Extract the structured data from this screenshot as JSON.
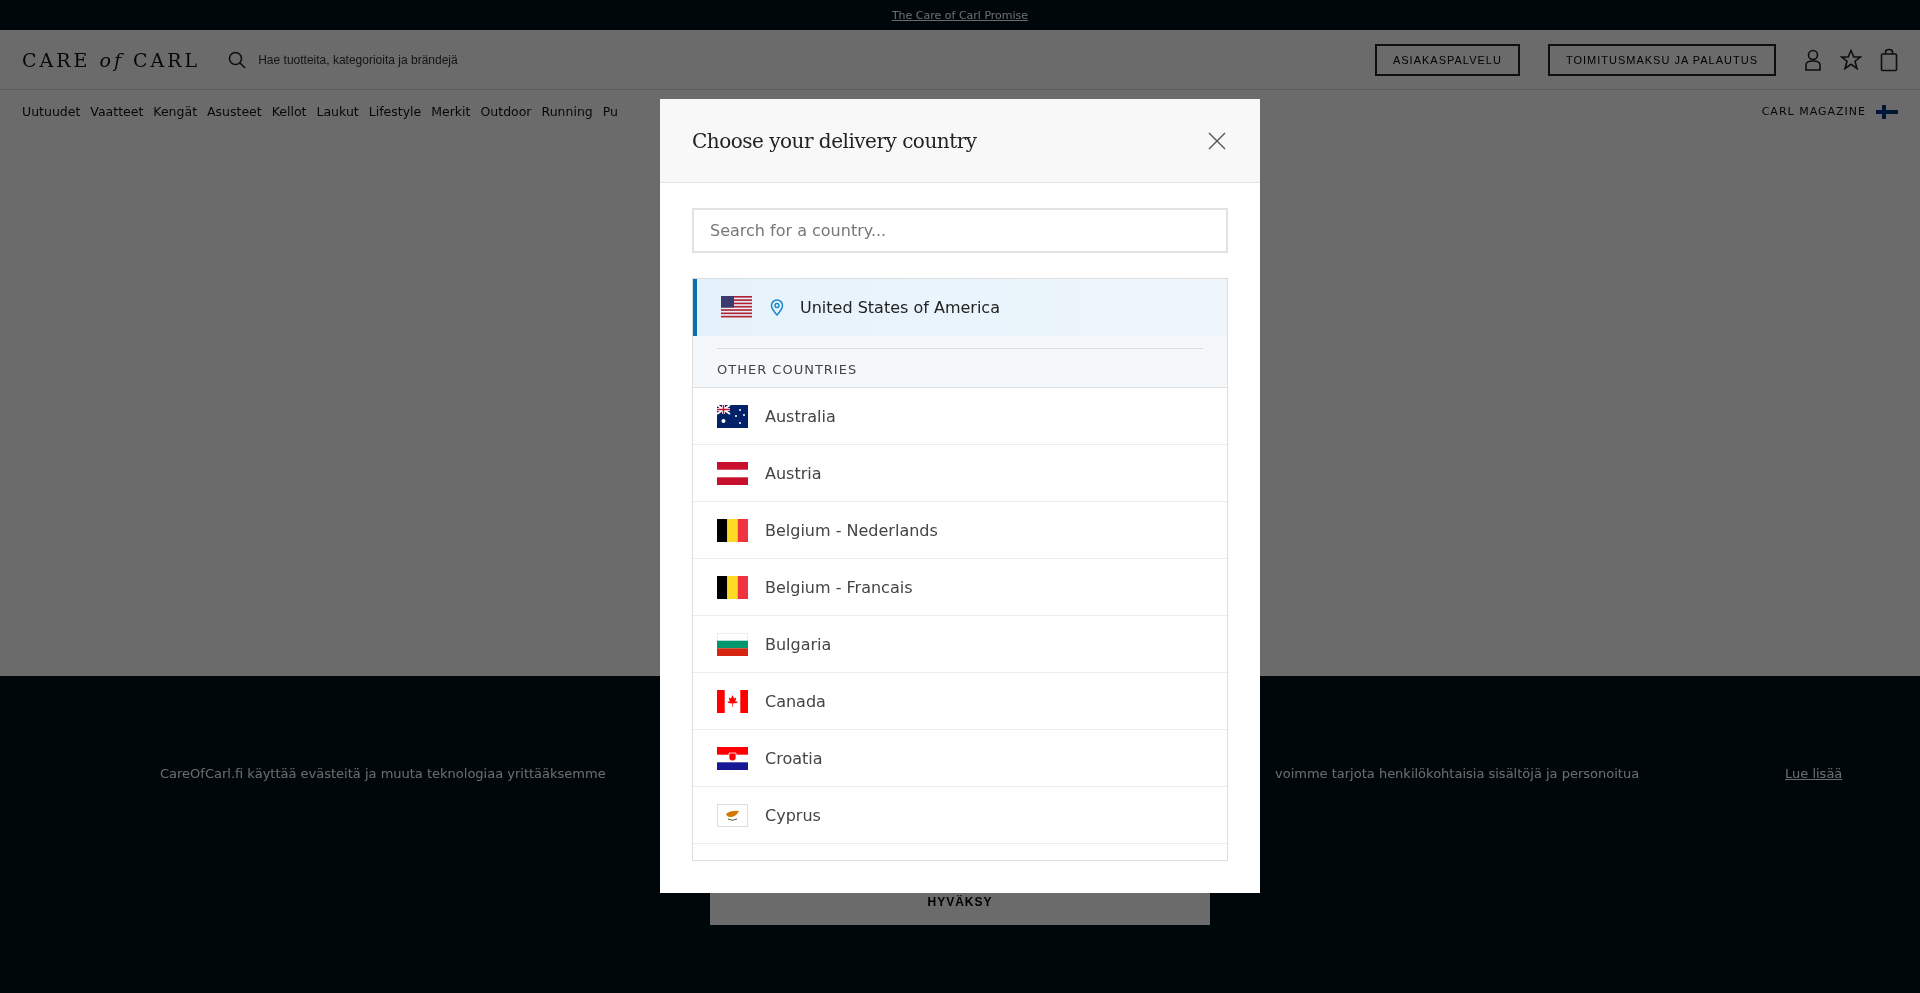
{
  "top_bar": {
    "link": "The Care of Carl Promise"
  },
  "header": {
    "logo": "CARE *of* CARL",
    "search": {
      "placeholder": "Hae tuotteita, kategorioita ja brändejä"
    },
    "buttons": [
      "ASIAKASPALVELU",
      "TOIMITUSMAKSU JA PALAUTUS"
    ]
  },
  "nav": {
    "items": [
      "Uutuudet",
      "Vaatteet",
      "Kengät",
      "Asusteet",
      "Kellot",
      "Laukut",
      "Lifestyle",
      "Merkit",
      "Outdoor",
      "Running",
      "Pu"
    ],
    "right_link": "CARL MAGAZINE"
  },
  "cookie_banner": {
    "text_left": "CareOfCarl.fi käyttää evästeitä ja muuta teknologiaa yrittääksemme",
    "text_right": "voimme tarjota henkilökohtaisia sisältöjä ja personoitua",
    "link": "Lue lisää",
    "accept_button": "HYVÄKSY"
  },
  "modal": {
    "title": "Choose your delivery country",
    "search": {
      "placeholder": "Search for a country..."
    },
    "current_country": {
      "name": "United States of America",
      "selected": true
    },
    "section_label": "OTHER COUNTRIES",
    "countries": [
      {
        "name": "Australia",
        "selected": false
      },
      {
        "name": "Austria",
        "selected": false
      },
      {
        "name": "Belgium - Nederlands",
        "selected": false
      },
      {
        "name": "Belgium - Francais",
        "selected": false
      },
      {
        "name": "Bulgaria",
        "selected": false
      },
      {
        "name": "Canada",
        "selected": false
      },
      {
        "name": "Croatia",
        "selected": false
      },
      {
        "name": "Cyprus",
        "selected": false
      }
    ]
  }
}
